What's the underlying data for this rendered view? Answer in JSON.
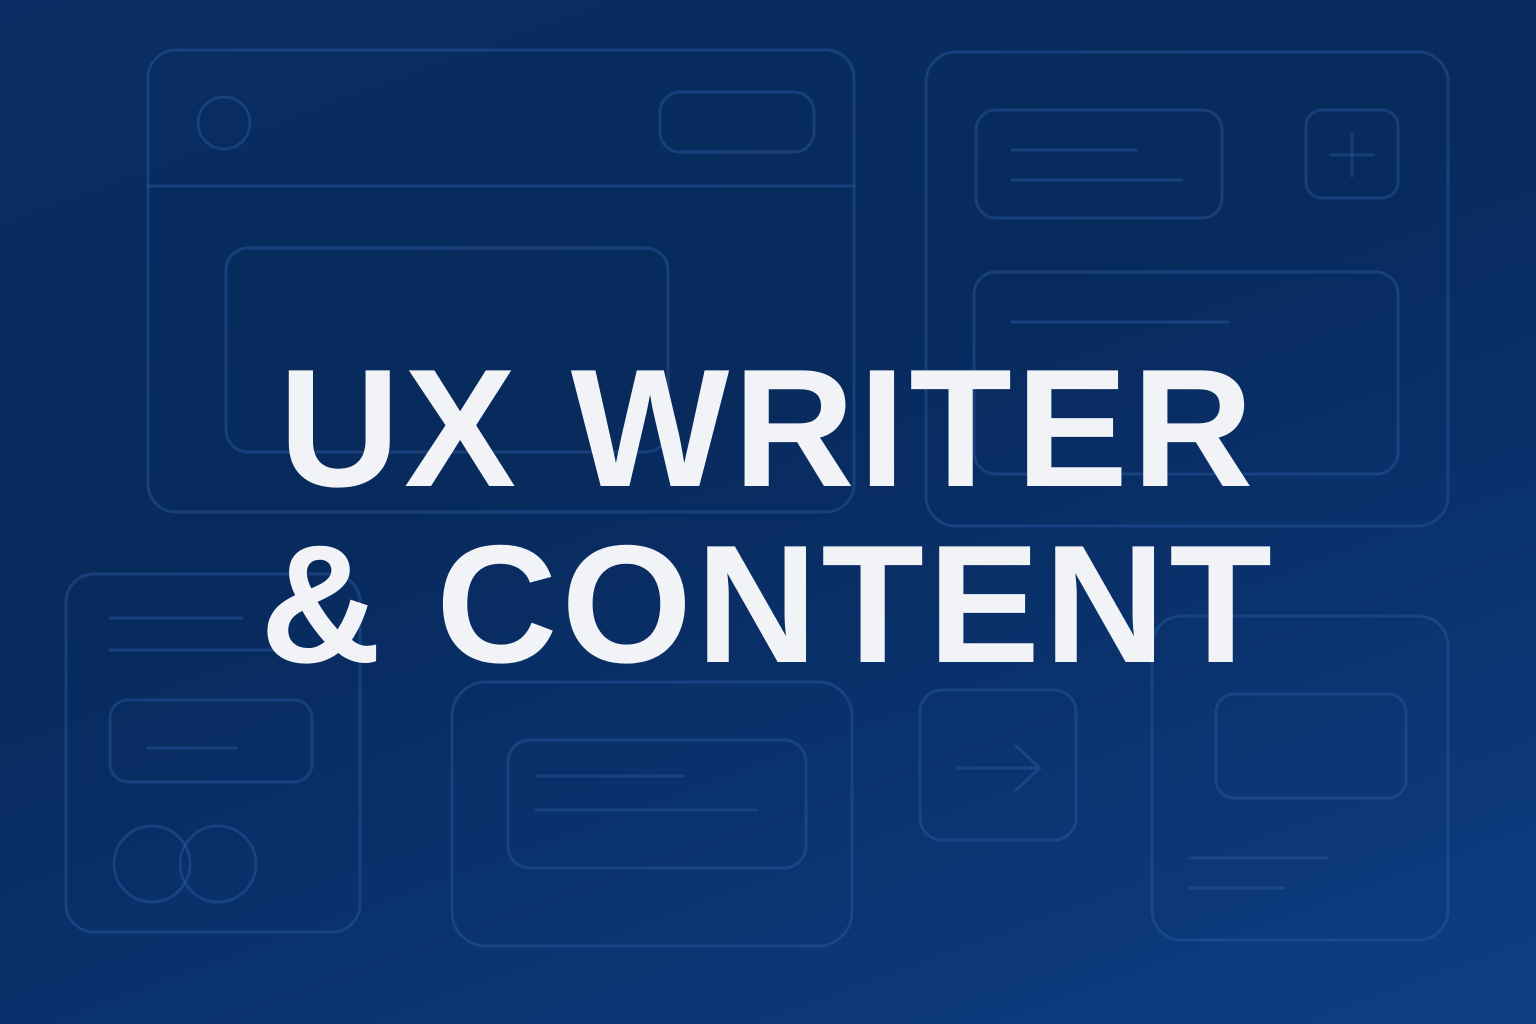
{
  "headline": {
    "line1": "UX WRITER",
    "line2": "& CONTENT"
  },
  "colors": {
    "background": "#0a2e63",
    "text": "#f1f3f7",
    "wireframe_stroke": "#2a5aa0"
  },
  "icons": [
    "plus-icon",
    "arrow-right-icon",
    "circle-icon",
    "double-circle-icon"
  ]
}
